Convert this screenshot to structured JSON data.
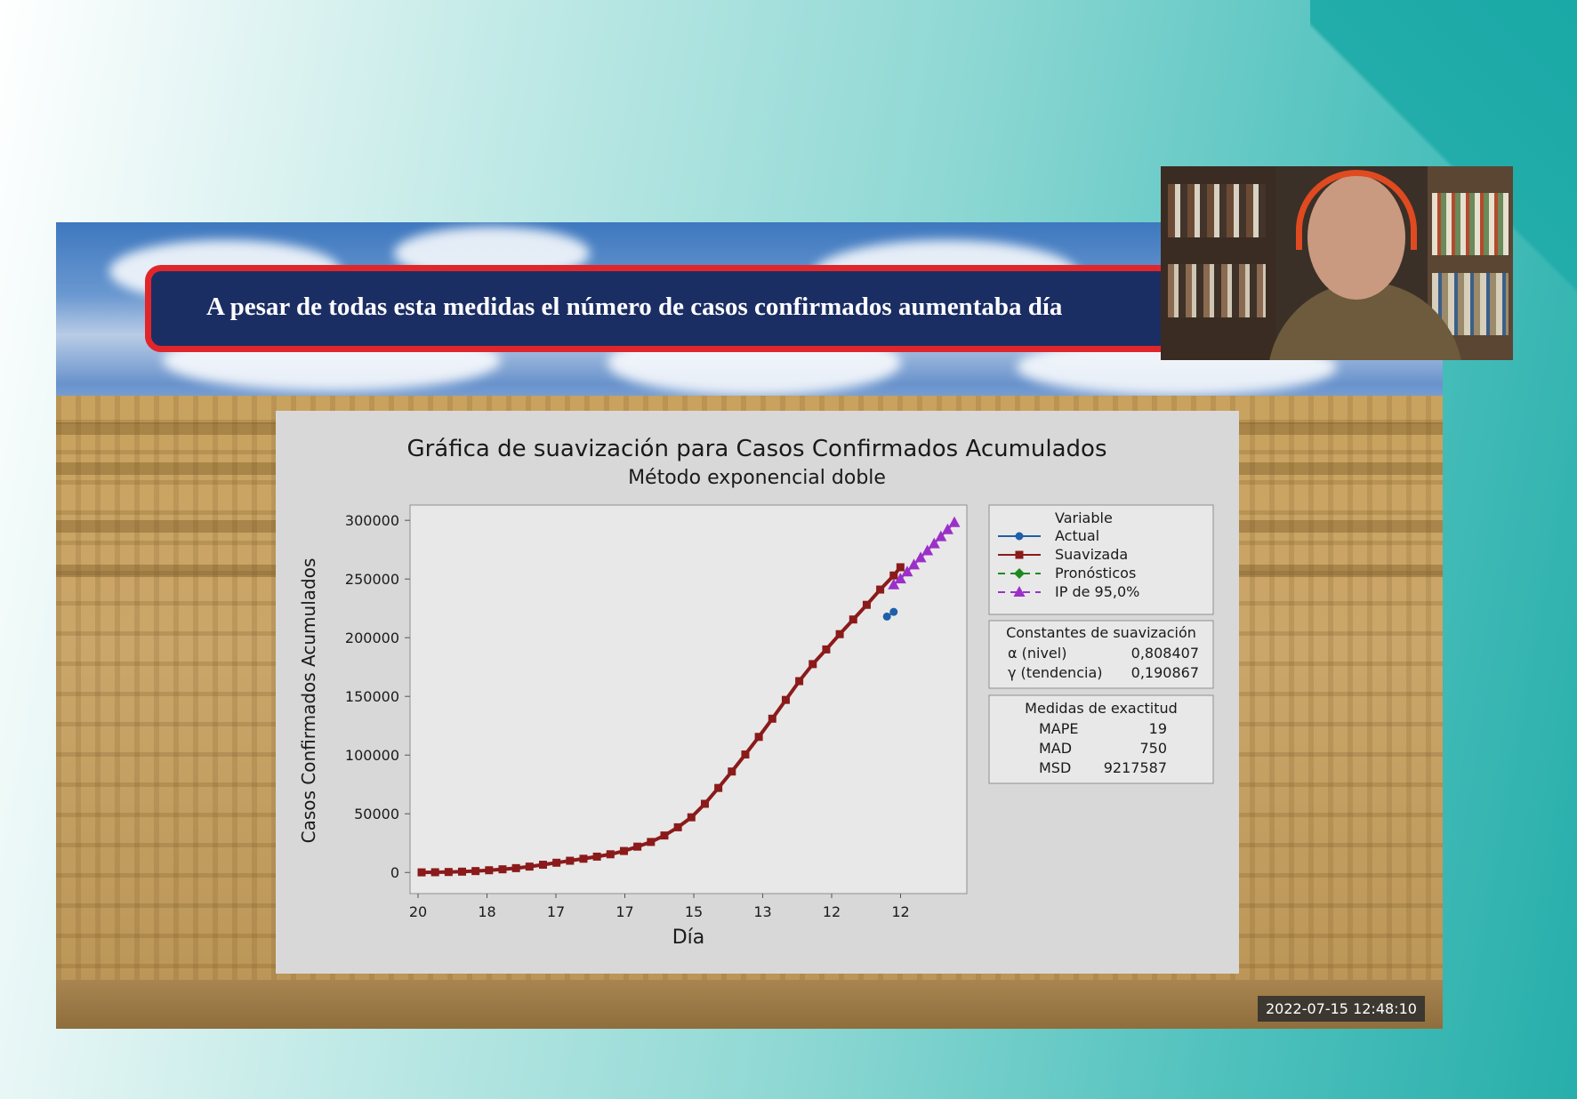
{
  "banner": {
    "text": "A pesar de todas esta medidas el número de casos confirmados aumentaba día"
  },
  "timestamp": "2022-07-15  12:48:10",
  "chart_data": {
    "type": "line",
    "title": "Gráfica de suavización  para Casos Confirmados Acumulados",
    "subtitle": "Método exponencial doble",
    "xlabel": "Día",
    "ylabel": "Casos Confirmados Acumulados",
    "x_tick_labels": [
      "20",
      "18",
      "17",
      "17",
      "15",
      "13",
      "12",
      "12"
    ],
    "y_ticks": [
      0,
      50000,
      100000,
      150000,
      200000,
      250000,
      300000
    ],
    "y_tick_labels": [
      "0",
      "50000",
      "100000",
      "150000",
      "200000",
      "250000",
      "300000"
    ],
    "ylim": [
      -18000,
      313000
    ],
    "grid": false,
    "legend": {
      "title": "Variable",
      "placement": "right",
      "entries": [
        {
          "name": "Actual",
          "color": "#1f5fa8",
          "marker": "circle",
          "dash": "solid"
        },
        {
          "name": "Suavizada",
          "color": "#8b1a1a",
          "marker": "square",
          "dash": "solid"
        },
        {
          "name": "Pronósticos",
          "color": "#1e8a1e",
          "marker": "diamond",
          "dash": "dashed"
        },
        {
          "name": "IP de 95,0%",
          "color": "#9b30c8",
          "marker": "triangle",
          "dash": "dashed"
        }
      ]
    },
    "smoothing_box": {
      "title": "Constantes de suavización",
      "rows": [
        {
          "label": "α (nivel)",
          "value": "0,808407"
        },
        {
          "label": "γ (tendencia)",
          "value": "0,190867"
        }
      ]
    },
    "accuracy_box": {
      "title": "Medidas de exactitud",
      "rows": [
        {
          "label": "MAPE",
          "value": "19"
        },
        {
          "label": "MAD",
          "value": "750"
        },
        {
          "label": "MSD",
          "value": "9217587"
        }
      ]
    },
    "x_index_range": [
      0,
      79
    ],
    "series": [
      {
        "name": "Suavizada",
        "x": [
          0,
          2,
          4,
          6,
          8,
          10,
          12,
          14,
          16,
          18,
          20,
          22,
          24,
          26,
          28,
          30,
          32,
          34,
          36,
          38,
          40,
          42,
          44,
          46,
          48,
          50,
          52,
          54,
          56,
          58,
          60,
          62,
          64,
          66,
          68,
          70,
          71
        ],
        "values": [
          100,
          200,
          400,
          700,
          1200,
          1900,
          2700,
          3700,
          5000,
          6600,
          8300,
          10000,
          11700,
          13500,
          15500,
          18300,
          22000,
          26000,
          31500,
          38500,
          47000,
          58500,
          72000,
          86000,
          100500,
          115500,
          131000,
          147000,
          163000,
          177500,
          190000,
          203000,
          215500,
          228000,
          241000,
          253000,
          260000
        ]
      },
      {
        "name": "IP de 95,0%",
        "x": [
          70,
          71,
          72,
          73,
          74,
          75,
          76,
          77,
          78,
          79
        ],
        "values": [
          245000,
          250000,
          256000,
          262000,
          268000,
          274000,
          280000,
          286000,
          292000,
          298000
        ]
      },
      {
        "name": "Actual",
        "x": [
          69,
          70
        ],
        "values": [
          218000,
          222000
        ]
      }
    ]
  }
}
